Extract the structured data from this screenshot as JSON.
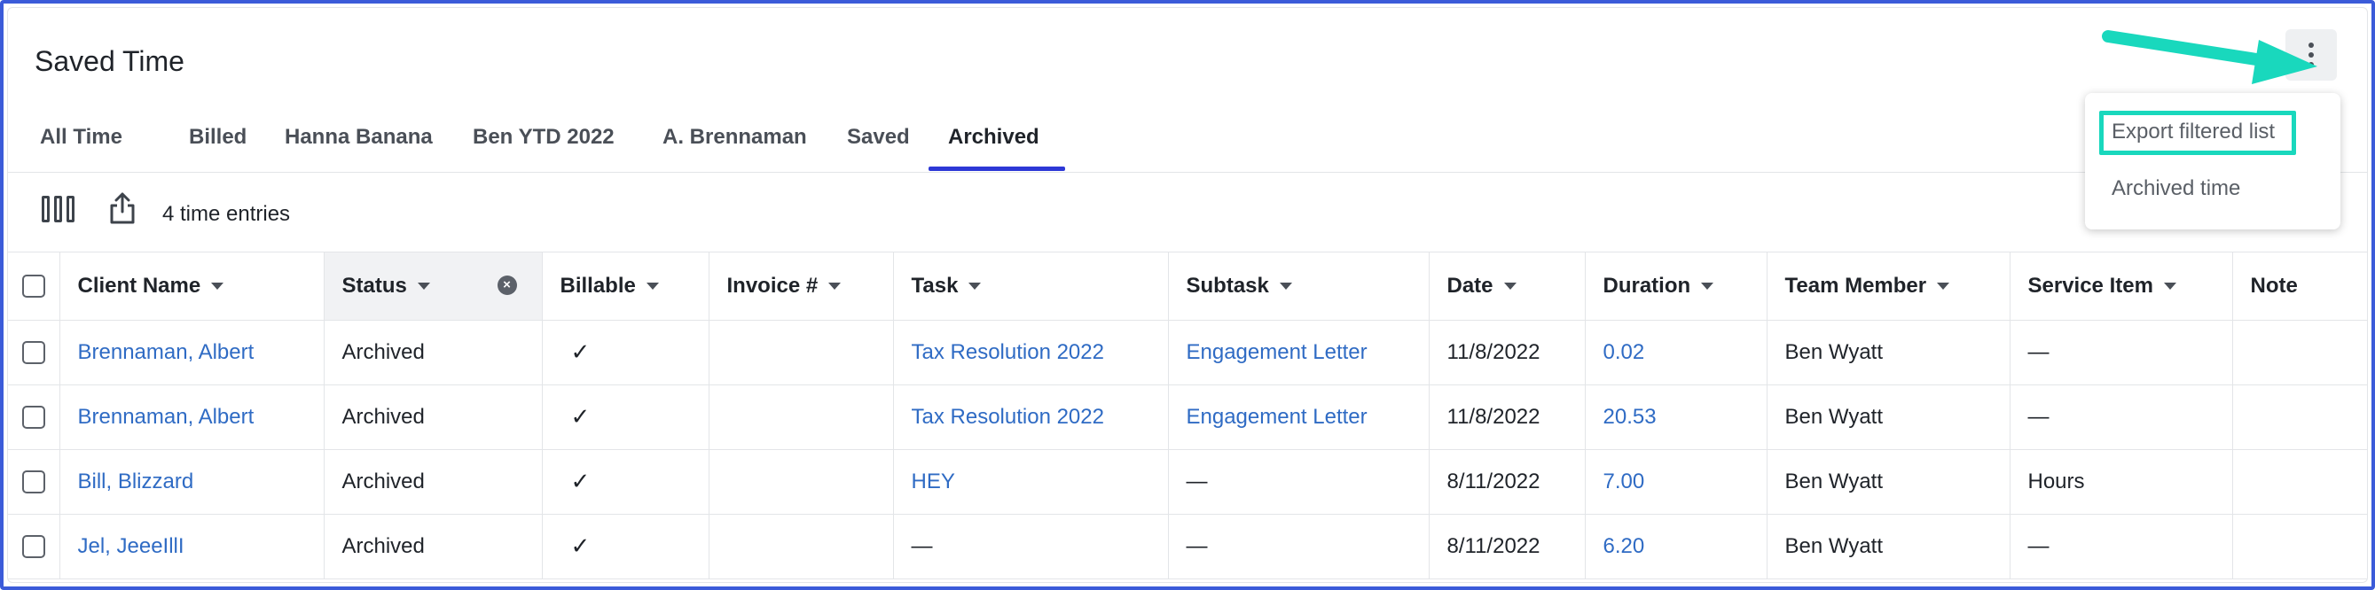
{
  "page": {
    "title": "Saved Time"
  },
  "tabs": [
    {
      "label": "All Time"
    },
    {
      "label": "Billed"
    },
    {
      "label": "Hanna Banana"
    },
    {
      "label": "Ben YTD 2022"
    },
    {
      "label": "A. Brennaman"
    },
    {
      "label": "Saved"
    },
    {
      "label": "Archived",
      "active": true
    }
  ],
  "toolbar": {
    "entries_count": "4 time entries"
  },
  "menu": {
    "items": [
      {
        "label": "Export filtered list",
        "highlighted": true
      },
      {
        "label": "Archived time"
      }
    ]
  },
  "table": {
    "columns": [
      "Client Name",
      "Status",
      "Billable",
      "Invoice #",
      "Task",
      "Subtask",
      "Date",
      "Duration",
      "Team Member",
      "Service Item",
      "Note"
    ],
    "rows": [
      {
        "client": "Brennaman, Albert",
        "status": "Archived",
        "billable": "✓",
        "invoice": "",
        "task": "Tax Resolution 2022",
        "subtask": "Engagement Letter",
        "date": "11/8/2022",
        "duration": "0.02",
        "member": "Ben Wyatt",
        "service": "—",
        "note": ""
      },
      {
        "client": "Brennaman, Albert",
        "status": "Archived",
        "billable": "✓",
        "invoice": "",
        "task": "Tax Resolution 2022",
        "subtask": "Engagement Letter",
        "date": "11/8/2022",
        "duration": "20.53",
        "member": "Ben Wyatt",
        "service": "—",
        "note": ""
      },
      {
        "client": "Bill, Blizzard",
        "status": "Archived",
        "billable": "✓",
        "invoice": "",
        "task": "HEY",
        "subtask": "—",
        "date": "8/11/2022",
        "duration": "7.00",
        "member": "Ben Wyatt",
        "service": "Hours",
        "note": ""
      },
      {
        "client": "Jel, JeeeIllI",
        "status": "Archived",
        "billable": "✓",
        "invoice": "",
        "task": "—",
        "subtask": "—",
        "date": "8/11/2022",
        "duration": "6.20",
        "member": "Ben Wyatt",
        "service": "—",
        "note": ""
      }
    ]
  },
  "colors": {
    "accent": "#2d38d6",
    "link": "#2f6bc4",
    "highlight": "#19d8bd",
    "frame": "#3b5bd9"
  },
  "icons": {
    "kebab": "more-vertical-icon",
    "columns": "columns-icon",
    "share": "share-icon",
    "clear": "clear-filter-icon",
    "caret": "caret-down-icon",
    "arrow": "annotation-arrow"
  }
}
